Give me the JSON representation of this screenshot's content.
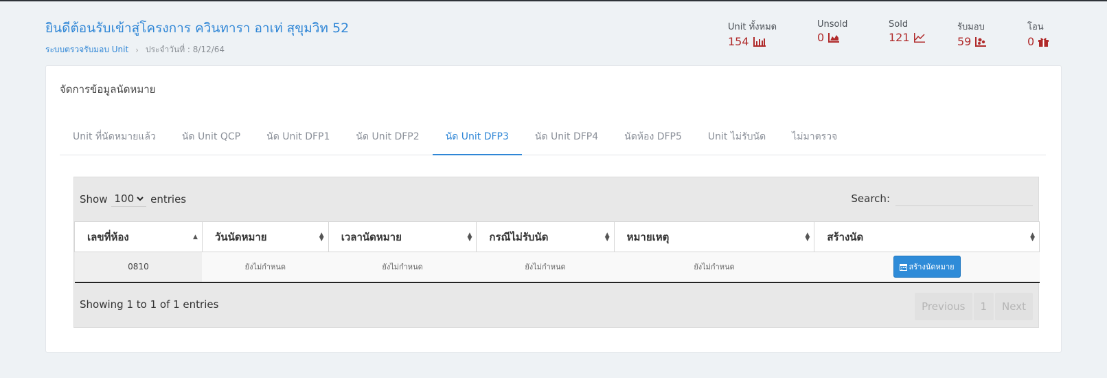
{
  "header": {
    "title": "ยินดีต้อนรับเข้าสู่โครงการ ควินทารา อาเท่ สุขุมวิท 52",
    "breadcrumb_system": "ระบบตรวจรับมอบ Unit",
    "breadcrumb_date": "ประจำวันที่ : 8/12/64"
  },
  "stats": [
    {
      "label": "Unit ทั้งหมด",
      "value": "154",
      "icon": "bar-chart-icon"
    },
    {
      "label": "Unsold",
      "value": "0",
      "icon": "area-chart-icon"
    },
    {
      "label": "Sold",
      "value": "121",
      "icon": "line-chart-icon"
    },
    {
      "label": "รับมอบ",
      "value": "59",
      "icon": "pie-chart-icon"
    },
    {
      "label": "โอน",
      "value": "0",
      "icon": "gift-icon"
    }
  ],
  "colors": {
    "accent": "#2f86d6",
    "stat_value": "#b02a2a",
    "button": "#2e8bd8"
  },
  "card": {
    "title": "จัดการข้อมูลนัดหมาย",
    "tabs": [
      "Unit ที่นัดหมายแล้ว",
      "นัด Unit QCP",
      "นัด Unit DFP1",
      "นัด Unit DFP2",
      "นัด Unit DFP3",
      "นัด Unit DFP4",
      "นัดห้อง DFP5",
      "Unit ไม่รับนัด",
      "ไม่มาตรวจ"
    ],
    "active_tab": "นัด Unit DFP3"
  },
  "table": {
    "show_label": "Show",
    "length_value": "100",
    "entries_label": "entries",
    "search_label": "Search:",
    "search_value": "",
    "columns": [
      "เลขที่ห้อง",
      "วันนัดหมาย",
      "เวลานัดหมาย",
      "กรณีไม่รับนัด",
      "หมายเหตุ",
      "สร้างนัด"
    ],
    "rows": [
      {
        "room": "0810",
        "date": "ยังไม่กำหนด",
        "time": "ยังไม่กำหนด",
        "reject": "ยังไม่กำหนด",
        "note": "ยังไม่กำหนด",
        "button": "สร้างนัดหมาย"
      }
    ],
    "info": "Showing 1 to 1 of 1 entries",
    "pagination": {
      "previous": "Previous",
      "page": "1",
      "next": "Next"
    }
  }
}
